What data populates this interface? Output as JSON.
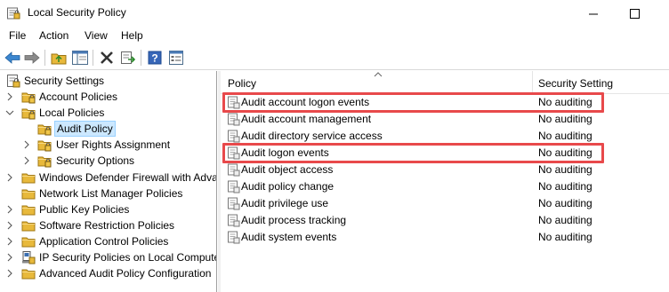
{
  "window": {
    "title": "Local Security Policy",
    "minimize_glyph": "—",
    "maximize_glyph": "☐"
  },
  "menu": [
    "File",
    "Action",
    "View",
    "Help"
  ],
  "toolbar": [
    "back-arrow-icon",
    "forward-arrow-icon",
    "up-folder-icon",
    "show-hide-tree-icon",
    "delete-icon",
    "export-list-icon",
    "help-icon",
    "properties-icon"
  ],
  "tree": {
    "root": "Security Settings",
    "items": [
      {
        "label": "Account Policies",
        "expandable": true,
        "expanded": false
      },
      {
        "label": "Local Policies",
        "expandable": true,
        "expanded": true
      },
      {
        "label": "Audit Policy",
        "selected": true
      },
      {
        "label": "User Rights Assignment",
        "expandable": true
      },
      {
        "label": "Security Options",
        "expandable": true
      },
      {
        "label": "Windows Defender Firewall with Adva",
        "expandable": true
      },
      {
        "label": "Network List Manager Policies",
        "expandable": false
      },
      {
        "label": "Public Key Policies",
        "expandable": true
      },
      {
        "label": "Software Restriction Policies",
        "expandable": true
      },
      {
        "label": "Application Control Policies",
        "expandable": true
      },
      {
        "label": "IP Security Policies on Local Compute",
        "expandable": true
      },
      {
        "label": "Advanced Audit Policy Configuration",
        "expandable": true
      }
    ]
  },
  "list": {
    "columns": {
      "policy": "Policy",
      "setting": "Security Setting"
    },
    "rows": [
      {
        "policy": "Audit account logon events",
        "setting": "No auditing",
        "highlighted": true
      },
      {
        "policy": "Audit account management",
        "setting": "No auditing"
      },
      {
        "policy": "Audit directory service access",
        "setting": "No auditing"
      },
      {
        "policy": "Audit logon events",
        "setting": "No auditing",
        "highlighted": true
      },
      {
        "policy": "Audit object access",
        "setting": "No auditing"
      },
      {
        "policy": "Audit policy change",
        "setting": "No auditing"
      },
      {
        "policy": "Audit privilege use",
        "setting": "No auditing"
      },
      {
        "policy": "Audit process tracking",
        "setting": "No auditing"
      },
      {
        "policy": "Audit system events",
        "setting": "No auditing"
      }
    ]
  },
  "colors": {
    "selection_bg": "#cce8ff",
    "highlight_border": "#e8494b",
    "folder_yellow": "#e8b93b"
  }
}
